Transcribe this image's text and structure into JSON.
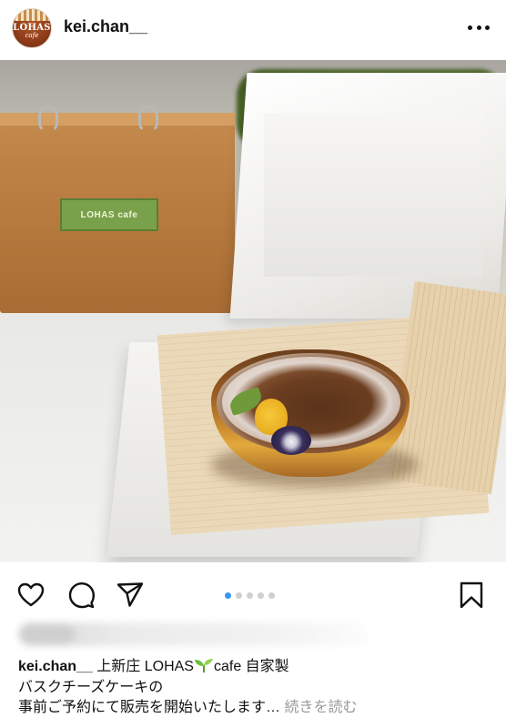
{
  "post": {
    "username": "kei.chan__",
    "avatar_brand": "LOHAS",
    "avatar_brand_sub": "cafe",
    "bag_label": "LOHAS cafe",
    "carousel": {
      "total": 5,
      "active": 1
    },
    "caption": {
      "username": "kei.chan__",
      "line1_before": "上新庄 LOHAS",
      "line1_after": "cafe 自家製",
      "line2": "バスクチーズケーキの",
      "line3": "事前ご予約にて販売を開始いたします…",
      "more_label": "続きを読む"
    }
  },
  "colors": {
    "accent_blue": "#3897f0",
    "text": "#111111",
    "muted": "#9a9a9a"
  },
  "icons": [
    "more-icon",
    "heart-icon",
    "comment-icon",
    "send-icon",
    "bookmark-icon",
    "sprout-icon"
  ]
}
